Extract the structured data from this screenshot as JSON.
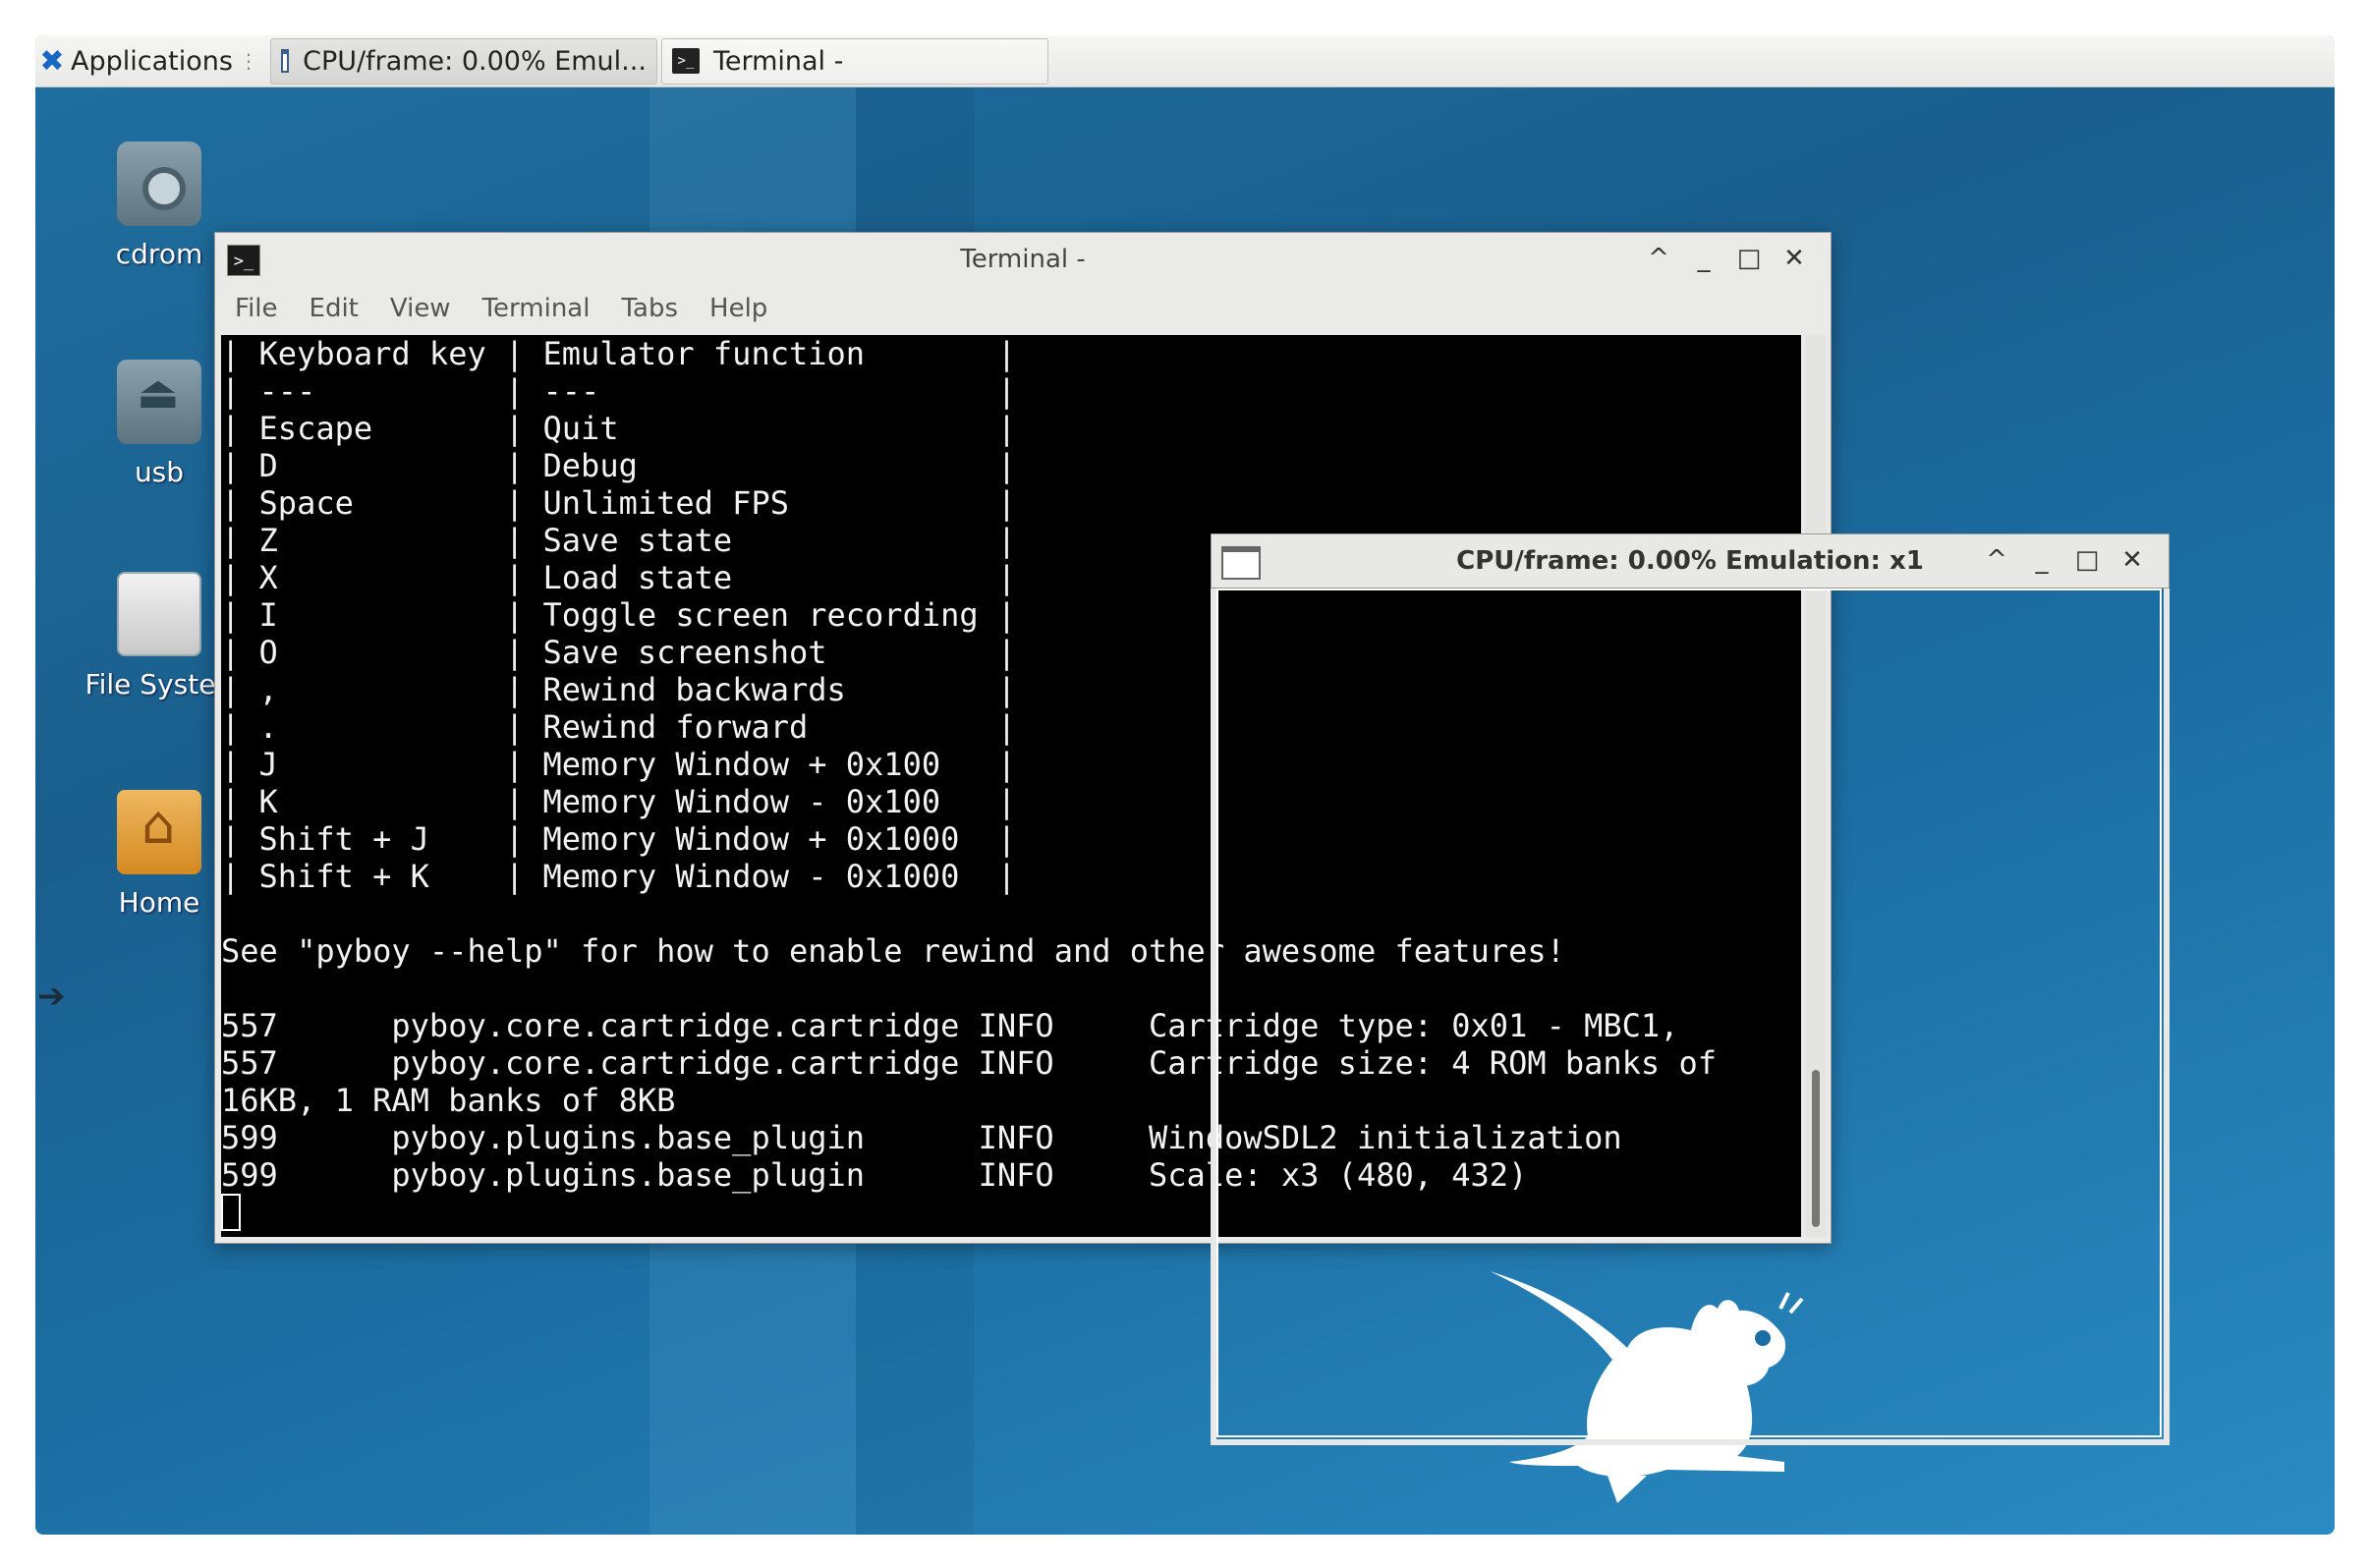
{
  "panel": {
    "applications_label": "Applications",
    "tasks": [
      {
        "label": "CPU/frame: 0.00% Emul...",
        "icon": "window-icon"
      },
      {
        "label": "Terminal -",
        "icon": "terminal-icon"
      }
    ]
  },
  "desktop_icons": [
    {
      "label": "cdrom",
      "icon": "cdrom-icon"
    },
    {
      "label": "usb",
      "icon": "usb-drive-icon"
    },
    {
      "label": "File Syste",
      "icon": "hard-drive-icon"
    },
    {
      "label": "Home",
      "icon": "home-folder-icon"
    }
  ],
  "terminal": {
    "title": "Terminal -",
    "menu": [
      "File",
      "Edit",
      "View",
      "Terminal",
      "Tabs",
      "Help"
    ],
    "lines": [
      "| Keyboard key | Emulator function       |",
      "| ---          | ---                     |",
      "| Escape       | Quit                    |",
      "| D            | Debug                   |",
      "| Space        | Unlimited FPS           |",
      "| Z            | Save state              |",
      "| X            | Load state              |",
      "| I            | Toggle screen recording |",
      "| O            | Save screenshot         |",
      "| ,            | Rewind backwards        |",
      "| .            | Rewind forward          |",
      "| J            | Memory Window + 0x100   |",
      "| K            | Memory Window - 0x100   |",
      "| Shift + J    | Memory Window + 0x1000  |",
      "| Shift + K    | Memory Window - 0x1000  |",
      "",
      "See \"pyboy --help\" for how to enable rewind and other awesome features!",
      "",
      "557      pyboy.core.cartridge.cartridge INFO     Cartridge type: 0x01 - MBC1,",
      "557      pyboy.core.cartridge.cartridge INFO     Cartridge size: 4 ROM banks of",
      "16KB, 1 RAM banks of 8KB",
      "599      pyboy.plugins.base_plugin      INFO     WindowSDL2 initialization",
      "599      pyboy.plugins.base_plugin      INFO     Scale: x3 (480, 432)"
    ]
  },
  "emulator": {
    "title": "CPU/frame: 0.00% Emulation: x1"
  },
  "window_controls": {
    "shade": "^",
    "minimize": "_",
    "maximize": "□",
    "close": "✕"
  }
}
